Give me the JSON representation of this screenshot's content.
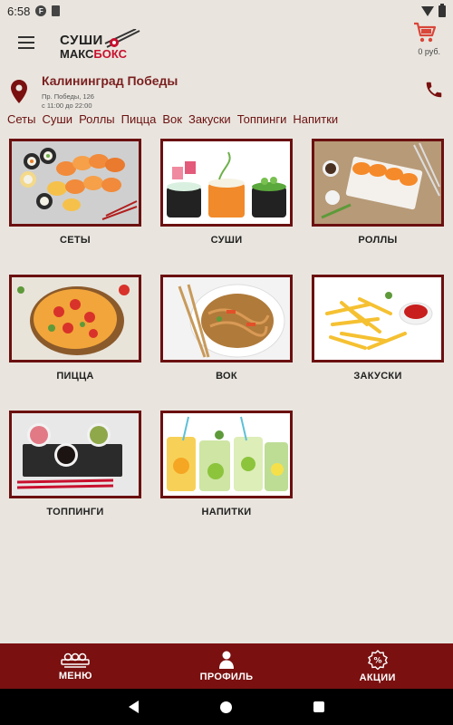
{
  "status_bar": {
    "time": "6:58"
  },
  "header": {
    "logo_line1": "СУШИ",
    "logo_line2a": "МАКС",
    "logo_line2b": "БОКС",
    "cart_sum": "0 руб."
  },
  "location": {
    "city": "Калининград Победы",
    "address": "Пр. Победы, 126",
    "hours": "с 11:00 до 22:00"
  },
  "categories_nav": [
    "Сеты",
    "Суши",
    "Роллы",
    "Пицца",
    "Вок",
    "Закуски",
    "Топпинги",
    "Напитки"
  ],
  "tiles": [
    {
      "label": "СЕТЫ",
      "image": "sushi-set-photo"
    },
    {
      "label": "СУШИ",
      "image": "sushi-photo"
    },
    {
      "label": "РОЛЛЫ",
      "image": "rolls-photo"
    },
    {
      "label": "ПИЦЦА",
      "image": "pizza-photo"
    },
    {
      "label": "ВОК",
      "image": "wok-noodles-photo"
    },
    {
      "label": "ЗАКУСКИ",
      "image": "fries-photo"
    },
    {
      "label": "ТОППИНГИ",
      "image": "sauces-photo"
    },
    {
      "label": "НАПИТКИ",
      "image": "lemonade-photo"
    }
  ],
  "bottom_nav": [
    {
      "label": "МЕНЮ",
      "icon": "sushi-tray-icon"
    },
    {
      "label": "ПРОФИЛЬ",
      "icon": "person-icon"
    },
    {
      "label": "АКЦИИ",
      "icon": "discount-badge-icon"
    }
  ],
  "colors": {
    "accent": "#7a1010",
    "background": "#e9e5de",
    "brand_red": "#c8102e",
    "cart_red": "#d9463a"
  }
}
